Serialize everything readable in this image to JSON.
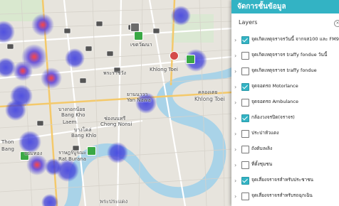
{
  "map": {
    "labels": [
      {
        "text": "เขตวัฒนา",
        "kind": "normal"
      },
      {
        "text": "พระราชวัง",
        "kind": "normal"
      },
      {
        "text": "Khlong Toei",
        "kind": "normal"
      },
      {
        "text": "ยานนาวา",
        "kind": "normal"
      },
      {
        "text": "Yan Nawa",
        "kind": "normal"
      },
      {
        "text": "คลองเตย",
        "kind": "normal"
      },
      {
        "text": "Khlong Toei",
        "kind": "big"
      },
      {
        "text": "บางกอกน้อย",
        "kind": "normal"
      },
      {
        "text": "Bang Kho",
        "kind": "normal"
      },
      {
        "text": "Laem",
        "kind": "normal"
      },
      {
        "text": "ช่องนนทรี",
        "kind": "normal"
      },
      {
        "text": "Chong Nonsi",
        "kind": "normal"
      },
      {
        "text": "บางโคล่",
        "kind": "normal"
      },
      {
        "text": "Bang Khlo",
        "kind": "normal"
      },
      {
        "text": "ราษฎร์บูรณะ",
        "kind": "normal"
      },
      {
        "text": "Rat Burana",
        "kind": "normal"
      },
      {
        "text": "จอมทอง",
        "kind": "normal"
      },
      {
        "text": "Thon",
        "kind": "normal"
      },
      {
        "text": "Bang",
        "kind": "normal"
      },
      {
        "text": "พระประแดง",
        "kind": "big"
      }
    ]
  },
  "panel": {
    "title": "จัดการชั้นข้อมูล",
    "layers_heading": "Layers",
    "collapse_icon": "×",
    "accent_color": "#33b3c4",
    "layers": [
      {
        "label": "จุดเกิดเหตุจราจรวันนี้ จากจส100 และ FM91",
        "checked": true
      },
      {
        "label": "จุดเกิดเหตุจราจร traffy fondue วันนี้",
        "checked": false
      },
      {
        "label": "จุดเกิดเหตุจราจร traffy fondue",
        "checked": false
      },
      {
        "label": "จุดจอดรถ Motorlance",
        "checked": true
      },
      {
        "label": "จุดจอดรถ Ambulance",
        "checked": false
      },
      {
        "label": "กล้องวงจรปิด(จราจร)",
        "checked": true
      },
      {
        "label": "ประปาหัวแดง",
        "checked": false
      },
      {
        "label": "ถังดับเพลิง",
        "checked": false
      },
      {
        "label": "ที่ตั้งชุมชน",
        "checked": false
      },
      {
        "label": "จุดเสี่ยงจราจรสำหรับประชาชน",
        "checked": true
      },
      {
        "label": "จุดเสี่ยงจราจรสำหรับรถฉุกเฉิน",
        "checked": false
      }
    ]
  }
}
